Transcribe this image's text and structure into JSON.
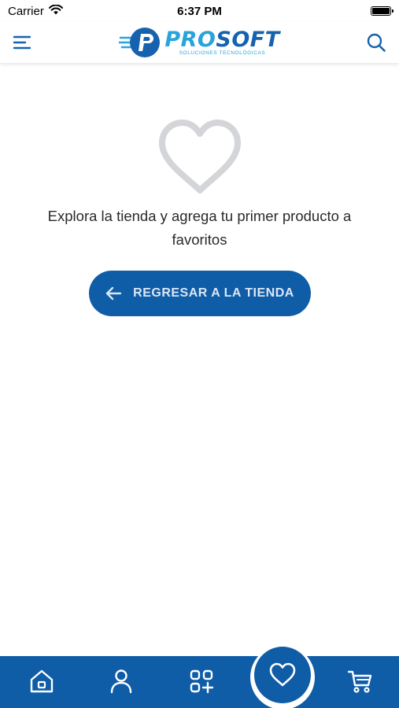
{
  "status_bar": {
    "carrier": "Carrier",
    "time": "6:37 PM"
  },
  "header": {
    "menu_icon": "hamburger-menu-icon",
    "logo": {
      "part1": "PRO",
      "part2": "SOFT",
      "tagline": "SOLUCIONES TECNOLÓGICAS"
    },
    "search_icon": "search-icon"
  },
  "empty_state": {
    "icon": "heart-outline-icon",
    "message": "Explora la tienda y agrega tu primer producto a favoritos",
    "button_label": "REGRESAR A LA TIENDA",
    "button_icon": "arrow-left-icon"
  },
  "bottom_nav": {
    "items": [
      {
        "icon": "home-icon",
        "active": false
      },
      {
        "icon": "user-icon",
        "active": false
      },
      {
        "icon": "categories-icon",
        "active": false
      },
      {
        "icon": "heart-icon",
        "active": true
      },
      {
        "icon": "cart-icon",
        "active": false
      }
    ]
  },
  "colors": {
    "primary": "#0f5ca7",
    "logo_light": "#29a3dc",
    "heart_gray": "#d3d5d8"
  }
}
